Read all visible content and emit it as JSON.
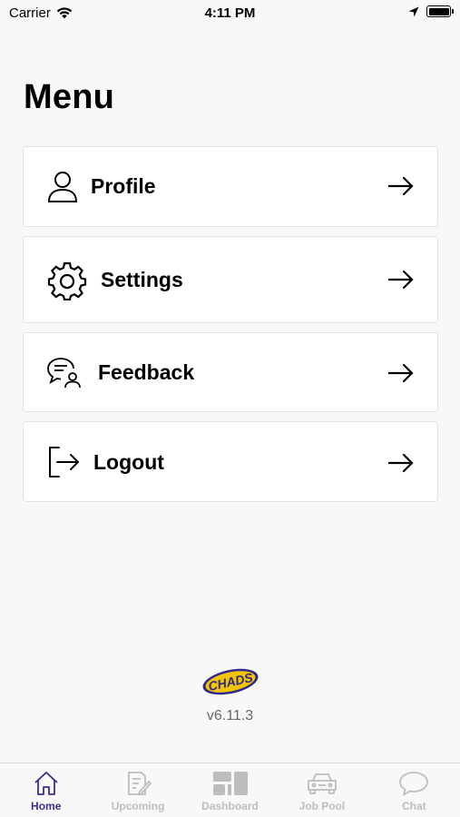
{
  "status_bar": {
    "carrier": "Carrier",
    "time": "4:11 PM"
  },
  "page": {
    "title": "Menu"
  },
  "menu": {
    "items": [
      {
        "label": "Profile",
        "icon": "person-icon"
      },
      {
        "label": "Settings",
        "icon": "gear-icon"
      },
      {
        "label": "Feedback",
        "icon": "feedback-icon"
      },
      {
        "label": "Logout",
        "icon": "logout-icon"
      }
    ]
  },
  "footer": {
    "logo_text": "CHADS",
    "version": "v6.11.3"
  },
  "tab_bar": {
    "tabs": [
      {
        "label": "Home",
        "icon": "home-icon",
        "active": true
      },
      {
        "label": "Upcoming",
        "icon": "document-edit-icon",
        "active": false
      },
      {
        "label": "Dashboard",
        "icon": "dashboard-icon",
        "active": false
      },
      {
        "label": "Job Pool",
        "icon": "car-icon",
        "active": false
      },
      {
        "label": "Chat",
        "icon": "chat-bubble-icon",
        "active": false
      }
    ]
  },
  "colors": {
    "background": "#f8f8f8",
    "card": "#ffffff",
    "active_tab": "#3b2e8e",
    "inactive_tab": "#bdbdbd",
    "logo_yellow": "#f5c400",
    "logo_blue": "#2e2a8c"
  }
}
